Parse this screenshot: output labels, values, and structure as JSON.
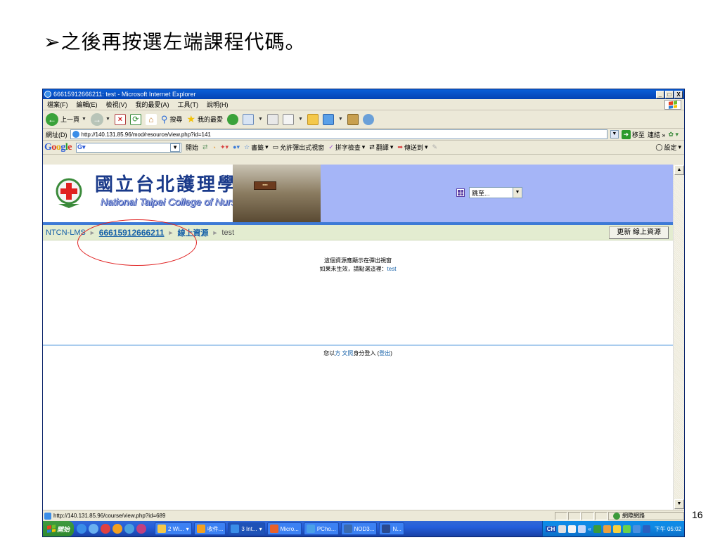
{
  "slide": {
    "title": "➢之後再按選左端課程代碼。",
    "page_number": "16"
  },
  "window": {
    "title": "66615912666211: test - Microsoft Internet Explorer",
    "controls": [
      "_",
      "□",
      "X"
    ]
  },
  "menu": {
    "items": [
      "檔案(F)",
      "編輯(E)",
      "檢視(V)",
      "我的最愛(A)",
      "工具(T)",
      "說明(H)"
    ]
  },
  "toolbar": {
    "back_label": "上一頁",
    "search_label": "搜尋",
    "favorites_label": "我的最愛"
  },
  "address": {
    "label": "網址(D)",
    "url": "http://140.131.85.96/mod/resource/view.php?id=141",
    "go_label": "移至",
    "links_label": "連結"
  },
  "google_bar": {
    "logo": "Google",
    "search_prefix": "G",
    "start_label": "開始",
    "bookmarks_label": "書籤",
    "popup_label": "允許彈出式視窗",
    "spell_label": "拼字檢查",
    "translate_label": "翻譯",
    "send_label": "傳送到",
    "settings_label": "設定"
  },
  "banner": {
    "school_cn": "國立台北護理學院",
    "school_en": "National Taipei College of Nursing",
    "jump_label": "跳至..."
  },
  "breadcrumb": {
    "site": "NTCN-LMS",
    "course": "66615912666211",
    "section": "線上資源",
    "current": "test",
    "update_button": "更新 線上資源"
  },
  "popup_message": {
    "line1": "這個資源應顯示在彈出視窗",
    "line2_prefix": "如果未生效，請點選這裡：",
    "line2_link": "test"
  },
  "login_info": {
    "prefix": "您以",
    "user": "方 文照",
    "middle": "身分登入 (",
    "logout": "登出",
    "suffix": ")"
  },
  "status_bar": {
    "url": "http://140.131.85.96/course/view.php?id=689",
    "zone": "網際網路"
  },
  "taskbar": {
    "start_label": "開始",
    "tasks": [
      "2 Wi...",
      "收件...",
      "3 Int...",
      "Micro...",
      "PCho...",
      "NOD3...",
      "N..."
    ],
    "lang": "CH",
    "clock": "下午 05:02"
  }
}
